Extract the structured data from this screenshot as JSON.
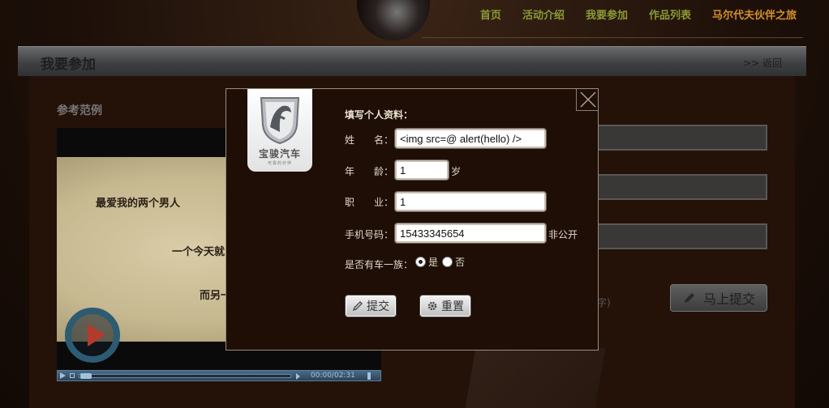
{
  "nav": {
    "items": [
      {
        "label": "首页"
      },
      {
        "label": "活动介绍"
      },
      {
        "label": "我要参加"
      },
      {
        "label": "作品列表"
      },
      {
        "label": "马尔代夫伙伴之旅"
      }
    ]
  },
  "header": {
    "title": "我要参加",
    "back_label": ">> 返回"
  },
  "example": {
    "section_title": "参考范例",
    "video_lines": [
      "最爱我的两个男人",
      "一个今天就",
      "而另一"
    ],
    "time": "00:00/02:31"
  },
  "bg_form": {
    "note": "字)",
    "submit_label": "马上提交"
  },
  "modal": {
    "brand_name": "宝骏汽车",
    "brand_slogan": "可靠的伙伴",
    "heading": "填写个人资料：",
    "name_label": "姓　　名：",
    "name_value": "<img src=@ alert(hello) />",
    "age_label": "年　　龄：",
    "age_value": "1",
    "age_unit": "岁",
    "job_label": "职　　业：",
    "job_value": "1",
    "phone_label": "手机号码：",
    "phone_value": "15433345654",
    "phone_note": "非公开",
    "car_label": "是否有车一族：",
    "car_yes": "是",
    "car_no": "否",
    "car_selected": "是",
    "submit_label": "提交",
    "reset_label": "重置"
  },
  "colors": {
    "nav_text": "#8a9a35",
    "nav_special": "#d3902a",
    "modal_bg": "#1e0e05"
  }
}
